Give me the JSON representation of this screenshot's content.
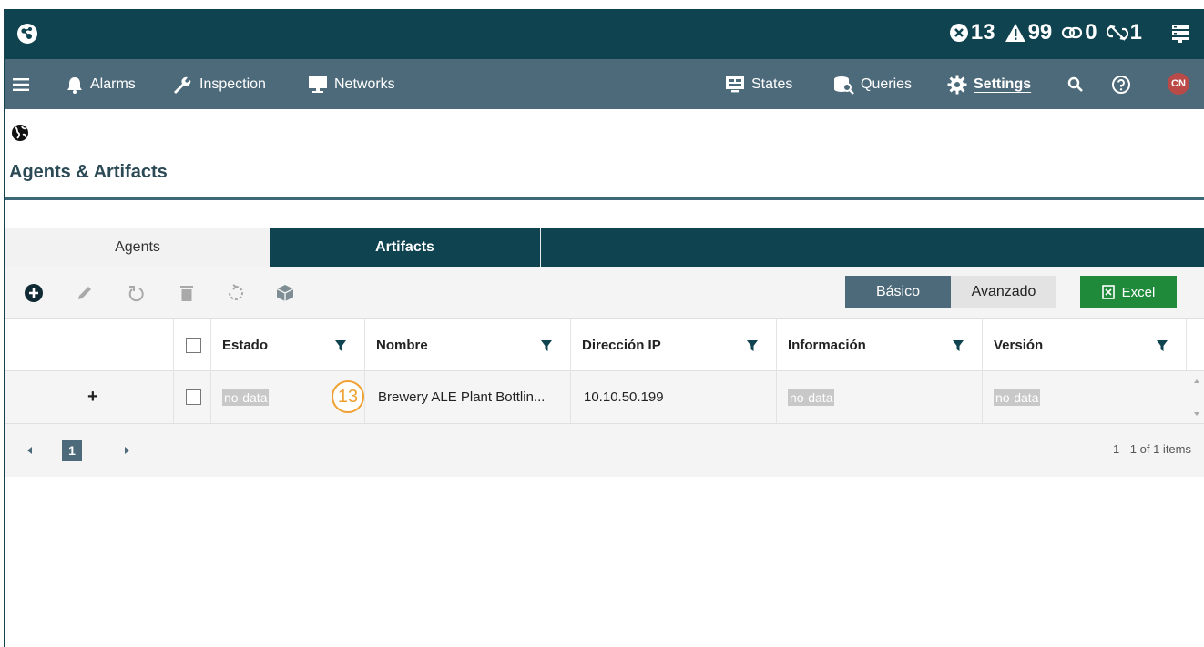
{
  "topbar": {
    "counters": [
      {
        "icon": "error-circle-icon",
        "value": "13"
      },
      {
        "icon": "warning-triangle-icon",
        "value": "99"
      },
      {
        "icon": "link-icon",
        "value": "0"
      },
      {
        "icon": "unlink-icon",
        "value": "1"
      }
    ]
  },
  "nav": {
    "alarms": "Alarms",
    "inspection": "Inspection",
    "networks": "Networks",
    "states": "States",
    "queries": "Queries",
    "settings": "Settings",
    "avatar_initials": "CN"
  },
  "page": {
    "title": "Agents & Artifacts"
  },
  "tabs": [
    "Agents",
    "Artifacts"
  ],
  "toolbar": {
    "mode_basic": "Básico",
    "mode_advanced": "Avanzado",
    "excel_label": "Excel"
  },
  "grid": {
    "columns": [
      "Estado",
      "Nombre",
      "Dirección IP",
      "Información",
      "Versión"
    ],
    "rows": [
      {
        "expand": "+",
        "estado": "no-data",
        "badge": "13",
        "nombre": "Brewery ALE Plant Bottlin...",
        "ip": "10.10.50.199",
        "informacion": "no-data",
        "version": "no-data"
      }
    ]
  },
  "pager": {
    "current_page": "1",
    "info": "1 - 1 of 1 items"
  },
  "colors": {
    "topbar": "#0f4350",
    "navbar": "#4d6a7a",
    "excel": "#1f8a3a",
    "badge": "#f0a030"
  }
}
